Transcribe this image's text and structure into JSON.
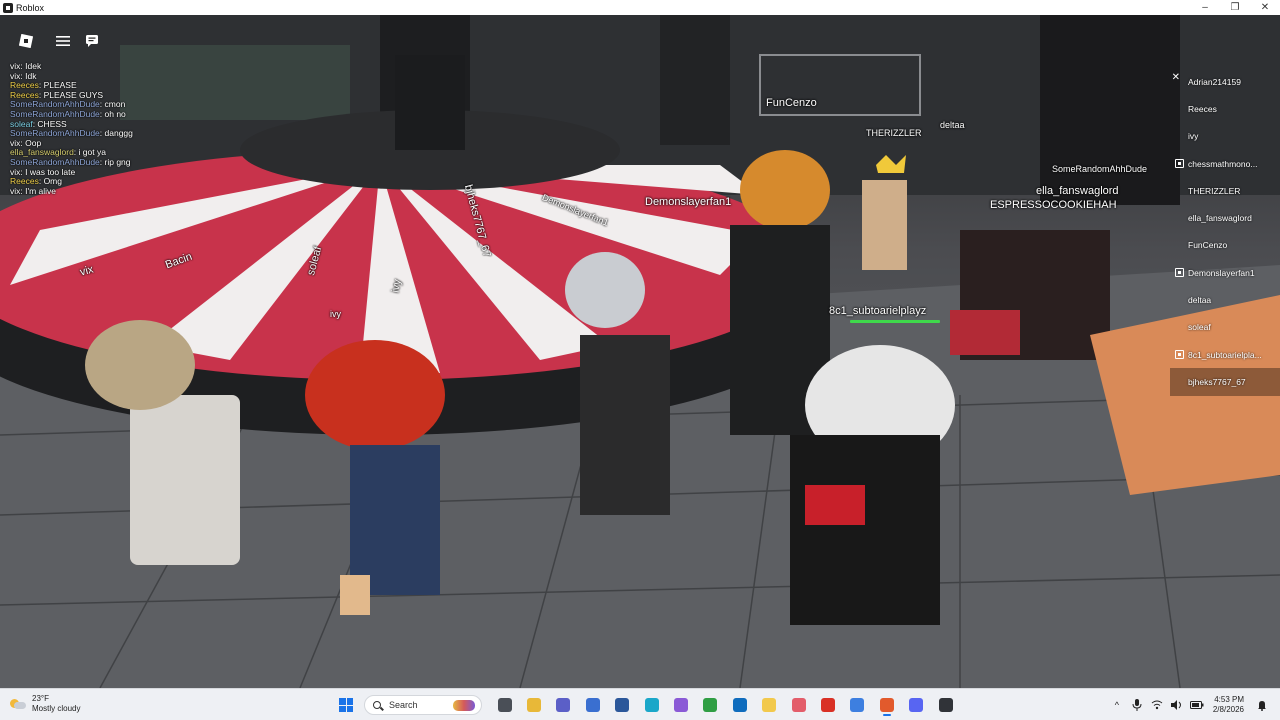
{
  "window": {
    "title": "Roblox",
    "controls": [
      "–",
      "❐",
      "✕"
    ]
  },
  "game": {
    "topbar": {
      "roblox_icon": "roblox-logo-icon",
      "menu_icon": "hamburger-menu-icon",
      "chat_icon": "chat-bubble-icon"
    },
    "chat": [
      {
        "name": "vix",
        "sep": ": ",
        "text": "Idek",
        "color": "#ffffff"
      },
      {
        "name": "vix",
        "sep": ": ",
        "text": "Idk",
        "color": "#ffffff"
      },
      {
        "name": "Reeces",
        "sep": ": ",
        "text": "PLEASE",
        "color": "#f0d04a"
      },
      {
        "name": "Reeces",
        "sep": ": ",
        "text": "PLEASE GUYS",
        "color": "#f0d04a"
      },
      {
        "name": "SomeRandomAhhDude",
        "sep": ": ",
        "text": "cmon",
        "color": "#8fa7d8"
      },
      {
        "name": "SomeRandomAhhDude",
        "sep": ": ",
        "text": "oh no",
        "color": "#8fa7d8"
      },
      {
        "name": "soleaf",
        "sep": ": ",
        "text": "CHESS",
        "color": "#7fd3e8"
      },
      {
        "name": "SomeRandomAhhDude",
        "sep": ": ",
        "text": "danggg",
        "color": "#8fa7d8"
      },
      {
        "name": "vix",
        "sep": ": ",
        "text": "Oop",
        "color": "#ffffff"
      },
      {
        "name": "ella_fanswaglord",
        "sep": ": ",
        "text": "i got ya",
        "color": "#d8d070"
      },
      {
        "name": "SomeRandomAhhDude",
        "sep": ": ",
        "text": "rip gng",
        "color": "#8fa7d8"
      },
      {
        "name": "vix",
        "sep": ": ",
        "text": "I was too late",
        "color": "#ffffff"
      },
      {
        "name": "Reeces",
        "sep": ": ",
        "text": "Omg",
        "color": "#f0d04a"
      },
      {
        "name": "vix",
        "sep": ": ",
        "text": "I'm alive",
        "color": "#ffffff"
      }
    ],
    "nametags": {
      "funcenzo": "FunCenzo",
      "therizzler": "THERIZZLER",
      "deltaa": "deltaa",
      "somerandom": "SomeRandomAhhDude",
      "ella": "ella_fanswaglord",
      "espresso": "ESPRESSOCOOKIEHAH",
      "subtoariel": "8c1_subtoarielplayz",
      "ivy": "ivy",
      "demonslayer": "Demonslayerfan1"
    },
    "board_labels": {
      "bjheks": "bjheks7767_67",
      "soleaf": "soleaf",
      "ivy": "ivy",
      "bacin": "Bacin",
      "vix": "vix",
      "demonslayer": "Demonslayerfan1"
    },
    "playerlist": {
      "close_icon": "close-icon",
      "players": [
        {
          "name": "Adrian214159",
          "icon": false
        },
        {
          "name": "Reeces",
          "icon": false
        },
        {
          "name": "ivy",
          "icon": false
        },
        {
          "name": "chessmathmono...",
          "icon": true
        },
        {
          "name": "THERIZZLER",
          "icon": false
        },
        {
          "name": "ella_fanswaglord",
          "icon": false
        },
        {
          "name": "FunCenzo",
          "icon": false
        },
        {
          "name": "Demonslayerfan1",
          "icon": true
        },
        {
          "name": "deltaa",
          "icon": false
        },
        {
          "name": "soleaf",
          "icon": false
        },
        {
          "name": "8c1_subtoarielpla...",
          "icon": true
        },
        {
          "name": "bjheks7767_67",
          "icon": false
        }
      ]
    }
  },
  "taskbar": {
    "weather": {
      "temp": "23°F",
      "desc": "Mostly cloudy",
      "icon": "partly-cloudy-icon"
    },
    "search_placeholder": "Search",
    "apps": [
      {
        "name": "task-view-icon",
        "color": "#4a4f57"
      },
      {
        "name": "file-explorer-icon",
        "color": "#e8b838"
      },
      {
        "name": "teams-icon",
        "color": "#5b5fc7"
      },
      {
        "name": "calculator-icon",
        "color": "#3a6fd0"
      },
      {
        "name": "word-icon",
        "color": "#2b579a"
      },
      {
        "name": "edge-icon",
        "color": "#1aa7c9"
      },
      {
        "name": "copilot-icon",
        "color": "#8a5ad6"
      },
      {
        "name": "chrome-icon",
        "color": "#2f9e44"
      },
      {
        "name": "outlook-icon",
        "color": "#0f6cbd"
      },
      {
        "name": "folder-icon",
        "color": "#f2c94c"
      },
      {
        "name": "snipping-tool-icon",
        "color": "#e35d6a"
      },
      {
        "name": "google-icon",
        "color": "#d93025"
      },
      {
        "name": "roblox-studio-icon",
        "color": "#3d7fe0"
      },
      {
        "name": "roblox-icon",
        "color": "#e25a2c"
      },
      {
        "name": "discord-icon",
        "color": "#5865f2"
      },
      {
        "name": "terminal-icon",
        "color": "#303338"
      }
    ],
    "tray": {
      "chevron": "^",
      "time": "4:53 PM",
      "date": "2/8/2026"
    }
  }
}
